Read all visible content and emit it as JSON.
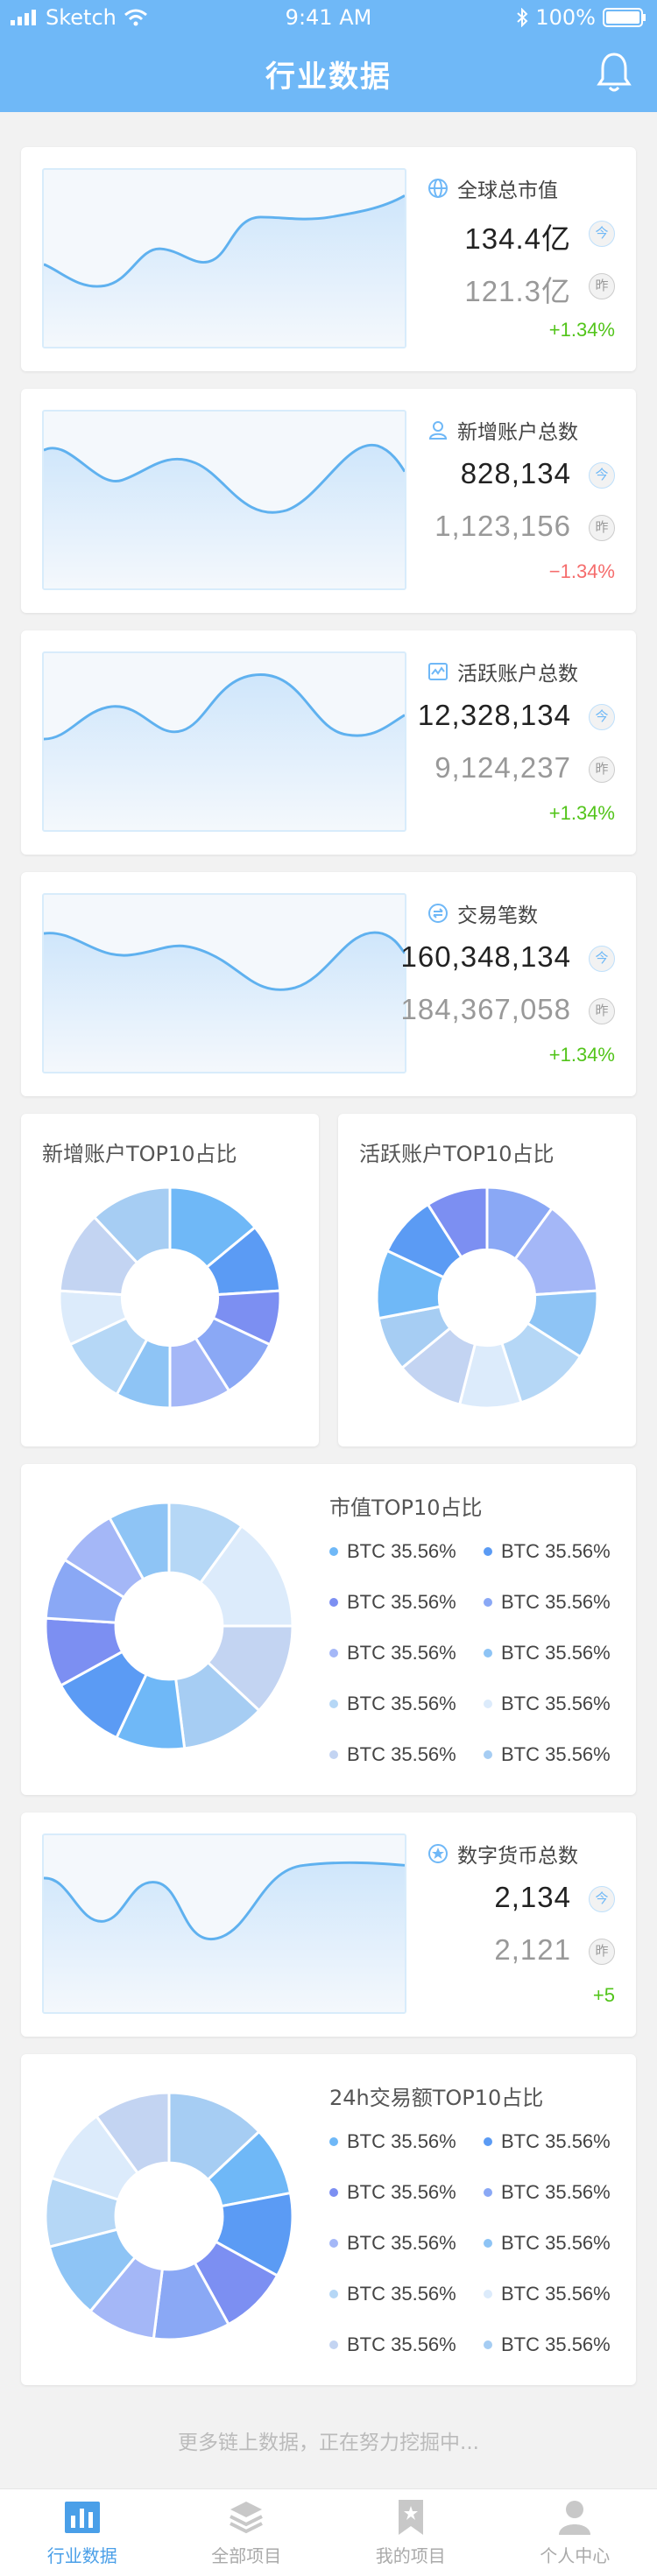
{
  "status_bar": {
    "carrier": "Sketch",
    "time": "9:41 AM",
    "battery": "100%"
  },
  "header": {
    "title": "行业数据",
    "bell_icon": "bell-icon"
  },
  "stats": [
    {
      "title": "全球总市值",
      "icon": "globe-icon",
      "today": "134.4亿",
      "yesterday": "121.3亿",
      "change": "+1.34%",
      "trend": "up",
      "today_badge": "今",
      "yesterday_badge": "昨"
    },
    {
      "title": "新增账户总数",
      "icon": "user-icon",
      "today": "828,134",
      "yesterday": "1,123,156",
      "change": "−1.34%",
      "trend": "down",
      "today_badge": "今",
      "yesterday_badge": "昨"
    },
    {
      "title": "活跃账户总数",
      "icon": "activity-icon",
      "today": "12,328,134",
      "yesterday": "9,124,237",
      "change": "+1.34%",
      "trend": "up",
      "today_badge": "今",
      "yesterday_badge": "昨"
    },
    {
      "title": "交易笔数",
      "icon": "transaction-icon",
      "today": "160,348,134",
      "yesterday": "184,367,058",
      "change": "+1.34%",
      "trend": "up",
      "today_badge": "今",
      "yesterday_badge": "昨"
    },
    {
      "title": "数字货币总数",
      "icon": "coin-icon",
      "today": "2,134",
      "yesterday": "2,121",
      "change": "+5",
      "trend": "up",
      "today_badge": "今",
      "yesterday_badge": "昨"
    }
  ],
  "donuts": {
    "new_accounts": {
      "title": "新增账户TOP10占比"
    },
    "active_accounts": {
      "title": "活跃账户TOP10占比"
    },
    "market_cap": {
      "title": "市值TOP10占比"
    },
    "volume_24h": {
      "title": "24h交易额TOP10占比"
    }
  },
  "legend_items": [
    "BTC 35.56%",
    "BTC 35.56%",
    "BTC 35.56%",
    "BTC 35.56%",
    "BTC 35.56%",
    "BTC 35.56%",
    "BTC 35.56%",
    "BTC 35.56%",
    "BTC 35.56%",
    "BTC 35.56%"
  ],
  "colors": {
    "accent": "#6fb8f7",
    "up": "#52c41a",
    "down": "#f56c6c",
    "palette": [
      "#6fb8f7",
      "#5b9bf4",
      "#7c8ff2",
      "#8aa8f5",
      "#a4b7f7",
      "#8ec4f5",
      "#b5d7f6",
      "#dcebfb",
      "#c3d4f2",
      "#a6cdf3"
    ]
  },
  "footer_note": "更多链上数据，正在努力挖掘中...",
  "tabs": [
    {
      "label": "行业数据",
      "icon": "bar-chart-icon",
      "active": true
    },
    {
      "label": "全部项目",
      "icon": "layers-icon",
      "active": false
    },
    {
      "label": "我的项目",
      "icon": "bookmark-icon",
      "active": false
    },
    {
      "label": "个人中心",
      "icon": "person-icon",
      "active": false
    }
  ]
}
